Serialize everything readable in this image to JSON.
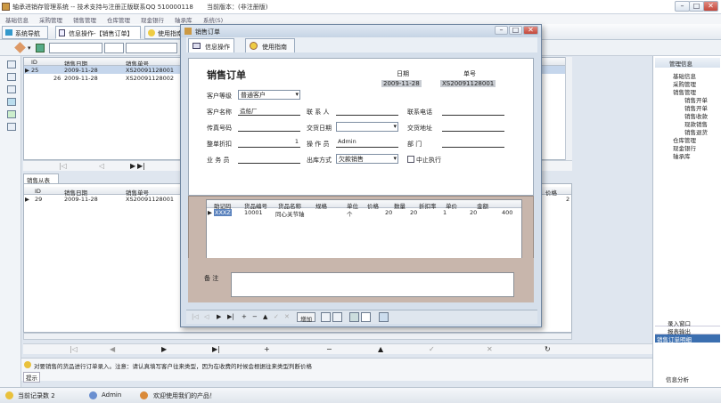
{
  "app": {
    "title": "轴承进销存管理系统 -- 技术支持与注册正版联系QQ 510000118",
    "version_label": "当前版本：(非注册版)"
  },
  "window_controls": {
    "min": "–",
    "max": "□",
    "close": "✕"
  },
  "menu": [
    "基础信息",
    "采购管理",
    "销售管理",
    "仓库管理",
    "现金银行",
    "轴承库",
    "系统(S)"
  ],
  "toolbar": {
    "nav_label": "系统导航",
    "tab1": "信息操作-【销售订单】",
    "tab2": "使用指南"
  },
  "main_grid": {
    "headers": [
      "ID",
      "销售日期",
      "销售单号"
    ],
    "rows": [
      [
        "25",
        "2009-11-28",
        "XS20091128001"
      ],
      [
        "26",
        "2009-11-28",
        "XS20091128002"
      ]
    ]
  },
  "main_nav": {
    "first": "|◁",
    "prev": "◁",
    "play": "▶",
    "last": "▶|"
  },
  "sub_grid": {
    "title": "销售从表",
    "headers": [
      "ID",
      "销售日期",
      "销售单号"
    ],
    "rows": [
      [
        "29",
        "2009-11-28",
        "XS20091128001"
      ]
    ],
    "extra_header": "价格",
    "extra_value": "2"
  },
  "bottom_nav": [
    "|◁",
    "◀",
    "▶",
    "▶|",
    "+",
    "−",
    "▲",
    "✓",
    "✕",
    "↻"
  ],
  "status": {
    "hint": "对要销售的货品进行订单录入。注意：请认真填写客户往来类型，因为在收费的时候会根据往来类型判断价格",
    "hint_tab": "提示",
    "records": "当前记录数 2",
    "user": "Admin",
    "welcome": "欢迎使用我们的产品！"
  },
  "right_panel": {
    "title": "管理信息",
    "tree": [
      "基础信息",
      "采购管理",
      "销售管理",
      "销售开单",
      "销售开单",
      "销售收款",
      "现款销售",
      "销售退货",
      "仓库管理",
      "现金银行",
      "轴承库"
    ],
    "bottom_items": [
      "录入窗口",
      "报表输出",
      "销售订单明细"
    ],
    "analysis": "信息分析"
  },
  "dialog": {
    "title": "销售订单",
    "tab1": "信息操作",
    "tab2": "使用指南",
    "form_title": "销售订单",
    "date_label": "日期",
    "date_value": "2009-11-28",
    "no_label": "单号",
    "no_value": "XS20091128001",
    "customer_level_label": "客户等级",
    "customer_level_value": "普通客户",
    "customer_name_label": "客户名称",
    "customer_name_value": "造船厂",
    "contact_label": "联 系 人",
    "contact_value": "",
    "phone_label": "联系电话",
    "phone_value": "",
    "fax_label": "传真号码",
    "fax_value": "",
    "delivery_date_label": "交货日期",
    "delivery_date_value": "",
    "delivery_addr_label": "交货地址",
    "delivery_addr_value": "",
    "discount_label": "整单折扣",
    "discount_value": "1",
    "operator_label": "操 作 员",
    "operator_value": "Admin",
    "dept_label": "部    门",
    "dept_value": "",
    "salesman_label": "业 务 员",
    "salesman_value": "",
    "ship_label": "出库方式",
    "ship_value": "欠款销售",
    "suspend_label": "中止执行",
    "detail_headers": [
      "助记码",
      "货品编号",
      "货品名称",
      "规格",
      "单位",
      "价格",
      "数量",
      "折扣率",
      "单价",
      "金额"
    ],
    "detail_row": [
      "XXXZ",
      "10001",
      "同心关节轴",
      "",
      "个",
      "20",
      "20",
      "1",
      "20",
      "400"
    ],
    "remark_label": "备    注",
    "detail_nav": [
      "|◁",
      "◁",
      "▶",
      "▶|",
      "+",
      "−",
      "▲",
      "✓",
      "✕",
      "↻"
    ],
    "bottom_nav": [
      "|◁",
      "◁",
      "▶",
      "▶|",
      "+",
      "−",
      "▲",
      "✓",
      "✕"
    ],
    "add_button": "增加"
  }
}
